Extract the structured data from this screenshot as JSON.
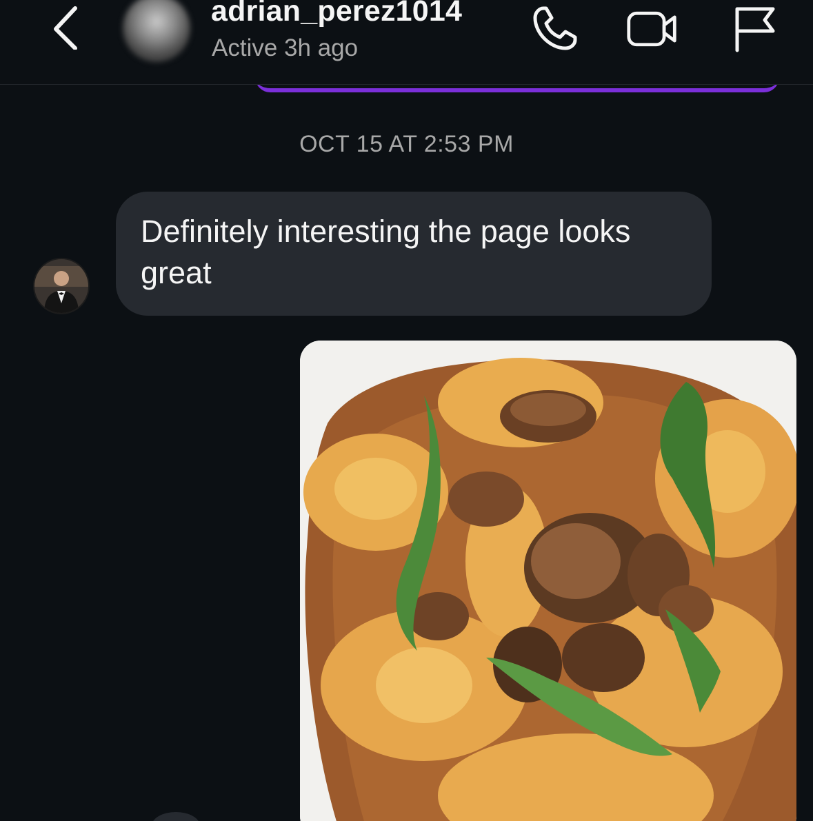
{
  "header": {
    "username": "adrian_perez1014",
    "status": "Active 3h ago",
    "icons": [
      "back-chevron-icon",
      "phone-icon",
      "video-camera-icon",
      "flag-icon"
    ]
  },
  "thread": {
    "timestamp": "OCT 15 AT 2:53 PM",
    "messages": [
      {
        "type": "text",
        "text": "Definitely interesting the page looks great"
      },
      {
        "type": "photo",
        "description_icon": "food-photo"
      }
    ]
  },
  "colors": {
    "background": "#0c1014",
    "bubble": "#262a30",
    "accent": "#7b2fd9",
    "secondary_text": "#a8a8a8"
  }
}
